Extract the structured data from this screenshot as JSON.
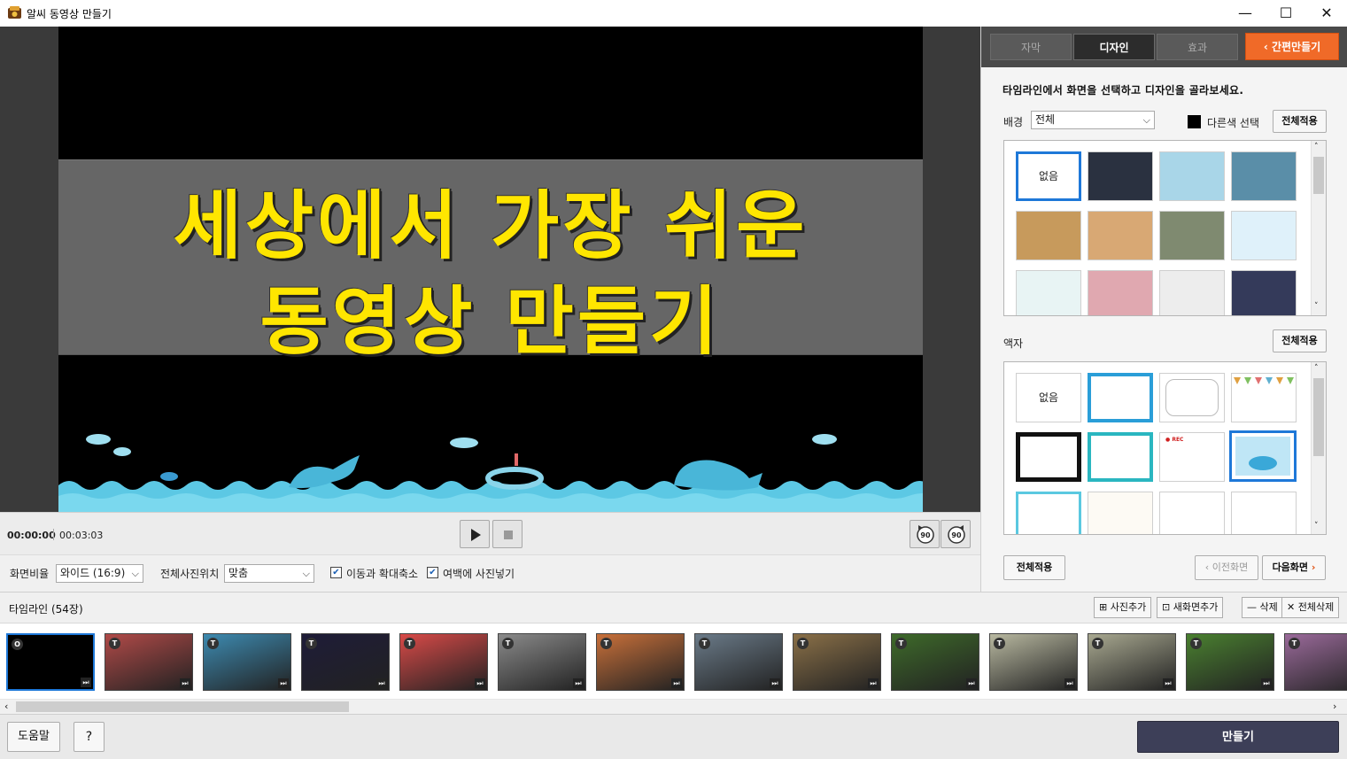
{
  "window": {
    "title": "알씨 동영상 만들기",
    "minimize": "—",
    "maximize": "☐",
    "close": "✕"
  },
  "preview": {
    "line1": "세상에서 가장 쉬운",
    "line2": "동영상 만들기"
  },
  "playback": {
    "current_time": "00:00:00",
    "total_time": "00:03:03",
    "rotate_left_label": "90",
    "rotate_right_label": "90"
  },
  "options": {
    "ratio_label": "화면비율",
    "ratio_value": "와이드 (16:9)",
    "photo_pos_label": "전체사진위치",
    "photo_pos_value": "맞춤",
    "zoom_label": "이동과 확대축소",
    "fill_label": "여백에 사진넣기"
  },
  "tabs": [
    {
      "label": "자막"
    },
    {
      "label": "디자인"
    },
    {
      "label": "효과"
    }
  ],
  "quick_make": "간편만들기",
  "design": {
    "instruction": "타임라인에서 화면을 선택하고 디자인을 골라보세요.",
    "background_label": "배경",
    "background_value": "전체",
    "other_color_label": "다른색 선택",
    "apply_all": "전체적용",
    "none_label": "없음",
    "frame_label": "액자",
    "prev_screen": "이전화면",
    "next_screen": "다음화면",
    "backgrounds": [
      {
        "color": "#ffffff"
      },
      {
        "color": "#2a3140"
      },
      {
        "color": "#a9d6e8"
      },
      {
        "color": "#5a8ea8"
      },
      {
        "color": "#c79a5c"
      },
      {
        "color": "#d8a874"
      },
      {
        "color": "#7f8a70"
      },
      {
        "color": "#dff1fa"
      },
      {
        "color": "#e8f4f4"
      },
      {
        "color": "#e0a8b0"
      },
      {
        "color": "#ededed"
      },
      {
        "color": "#343a5a"
      }
    ]
  },
  "timeline": {
    "title": "타임라인 (54장)",
    "add_photo": "사진추가",
    "add_screen": "새화면추가",
    "delete": "삭제",
    "delete_all": "전체삭제",
    "clips": [
      {
        "badge": "O",
        "color": "#000000"
      },
      {
        "badge": "T",
        "color": "#b04a48"
      },
      {
        "badge": "T",
        "color": "#3d8ab0"
      },
      {
        "badge": "T",
        "color": "#1e1c38"
      },
      {
        "badge": "T",
        "color": "#d84a48"
      },
      {
        "badge": "T",
        "color": "#8a8a8a"
      },
      {
        "badge": "T",
        "color": "#c8703a"
      },
      {
        "badge": "T",
        "color": "#6a7a88"
      },
      {
        "badge": "T",
        "color": "#8a7048"
      },
      {
        "badge": "T",
        "color": "#3e6a2a"
      },
      {
        "badge": "T",
        "color": "#b8b8a0"
      },
      {
        "badge": "T",
        "color": "#a8a890"
      },
      {
        "badge": "T",
        "color": "#4a8030"
      },
      {
        "badge": "T",
        "color": "#9a6a9a"
      }
    ]
  },
  "footer": {
    "help": "도움말",
    "question": "?",
    "make": "만들기"
  }
}
